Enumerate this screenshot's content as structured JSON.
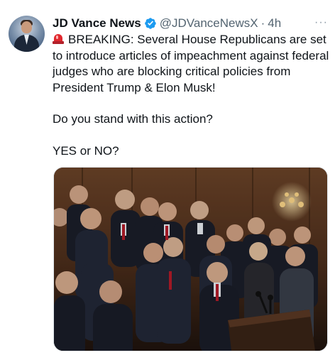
{
  "tweet": {
    "author_name": "JD Vance News",
    "handle": "@JDVanceNewsX",
    "separator": "·",
    "time": "4h",
    "more_label": "···",
    "avatar_icon": "avatar-photo",
    "verified_icon": "verified-badge-icon",
    "verified_color": "#1d9bf0",
    "emoji_icon": "police-siren-icon",
    "text_line1": "BREAKING: Several House Republicans are set to introduce articles of impeachment against federal judges who are blocking critical policies from President Trump & Elon Musk!",
    "text_line2": "Do you stand with this action?",
    "text_line3": "YES or NO?",
    "media_icon": "group-photo-press-conference"
  }
}
